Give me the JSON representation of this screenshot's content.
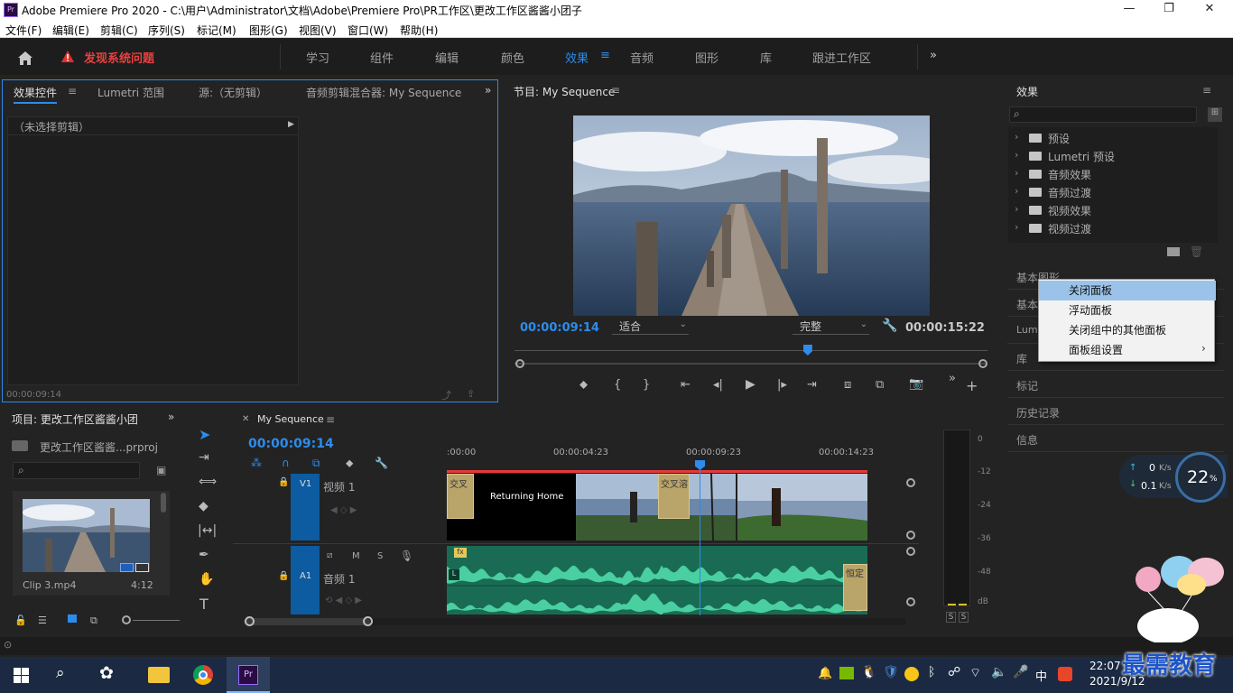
{
  "window": {
    "title": "Adobe Premiere Pro 2020 - C:\\用户\\Administrator\\文档\\Adobe\\Premiere Pro\\PR工作区\\更改工作区酱酱小团子",
    "app_icon": "Pr"
  },
  "menu": [
    "文件(F)",
    "编辑(E)",
    "剪辑(C)",
    "序列(S)",
    "标记(M)",
    "图形(G)",
    "视图(V)",
    "窗口(W)",
    "帮助(H)"
  ],
  "workspace": {
    "warning": "发现系统问题",
    "tabs": [
      "学习",
      "组件",
      "编辑",
      "颜色",
      "效果",
      "音频",
      "图形",
      "库",
      "跟进工作区"
    ],
    "active": "效果"
  },
  "effect_controls": {
    "tabs": [
      "效果控件",
      "Lumetri 范围",
      "源:（无剪辑）",
      "音频剪辑混合器: My Sequence"
    ],
    "no_clip": "（未选择剪辑）",
    "timecode": "00:00:09:14"
  },
  "program_monitor": {
    "title": "节目: My Sequence",
    "timecode": "00:00:09:14",
    "fit": "适合",
    "quality": "完整",
    "duration": "00:00:15:22",
    "playhead_fraction": 0.62
  },
  "project": {
    "title": "项目: 更改工作区酱酱小团",
    "file": "更改工作区酱酱...prproj",
    "clip_name": "Clip 3.mp4",
    "clip_duration": "4:12"
  },
  "timeline": {
    "title": "My Sequence",
    "timecode": "00:00:09:14",
    "ruler": [
      ":00:00",
      "00:00:04:23",
      "00:00:09:23",
      "00:00:14:23"
    ],
    "video_track": {
      "id": "V1",
      "name": "视频 1"
    },
    "audio_track": {
      "id": "A1",
      "name": "音频 1"
    },
    "title_clip": "Returning Home",
    "transition_label_1": "交叉",
    "transition_label_2": "交叉溶",
    "audio_transition": "恒定",
    "fx": "fx",
    "audio_flag": "L",
    "m": "M",
    "s": "S"
  },
  "meter": {
    "scale": [
      "0",
      "-12",
      "-24",
      "-36",
      "-48",
      "dB"
    ],
    "solo": [
      "S",
      "S"
    ]
  },
  "effects_panel": {
    "title": "效果",
    "tree": [
      "预设",
      "Lumetri 预设",
      "音频效果",
      "音频过渡",
      "视频效果",
      "视频过渡"
    ]
  },
  "right_panels": {
    "graphics": "基本图形",
    "basic": "基本",
    "lumetri": "Lume",
    "library": "库",
    "markers": "标记",
    "history": "历史记录",
    "info": "信息"
  },
  "context_menu": [
    "关闭面板",
    "浮动面板",
    "关闭组中的其他面板",
    "面板组设置"
  ],
  "network": {
    "up": "0",
    "down": "0.1",
    "unit": "K/s",
    "cpu": "22",
    "cpu_unit": "%"
  },
  "taskbar": {
    "time": "22:07",
    "date": "2021/9/12",
    "ime": "中"
  },
  "watermark": "最需教育"
}
